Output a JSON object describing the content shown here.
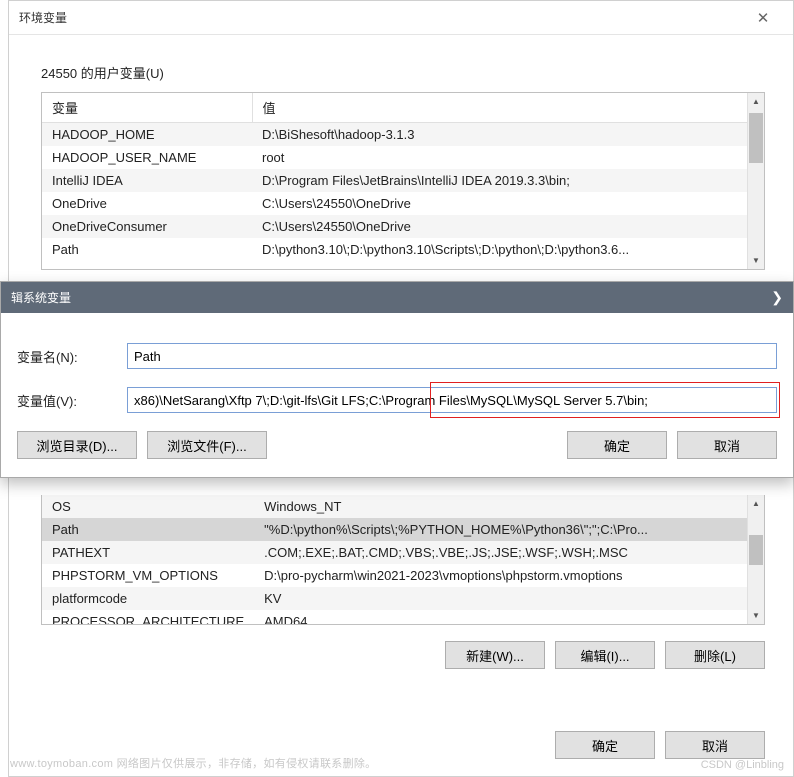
{
  "dialog": {
    "title": "环境变量",
    "close_glyph": "✕"
  },
  "user_section": {
    "label": "24550 的用户变量(U)",
    "header_var": "变量",
    "header_val": "值",
    "rows": [
      {
        "var": "HADOOP_HOME",
        "val": "D:\\BiShesoft\\hadoop-3.1.3"
      },
      {
        "var": "HADOOP_USER_NAME",
        "val": "root"
      },
      {
        "var": "IntelliJ IDEA",
        "val": "D:\\Program Files\\JetBrains\\IntelliJ IDEA 2019.3.3\\bin;"
      },
      {
        "var": "OneDrive",
        "val": "C:\\Users\\24550\\OneDrive"
      },
      {
        "var": "OneDriveConsumer",
        "val": "C:\\Users\\24550\\OneDrive"
      },
      {
        "var": "Path",
        "val": "D:\\python3.10\\;D:\\python3.10\\Scripts\\;D:\\python\\;D:\\python3.6..."
      }
    ]
  },
  "edit_dialog": {
    "title": "辑系统变量",
    "close_glyph": "❯",
    "name_label": "变量名(N):",
    "value_label": "变量值(V):",
    "name_value": "Path",
    "value_value": "x86)\\NetSarang\\Xftp 7\\;D:\\git-lfs\\Git LFS;C:\\Program Files\\MySQL\\MySQL Server 5.7\\bin;",
    "browse_dir": "浏览目录(D)...",
    "browse_file": "浏览文件(F)...",
    "ok": "确定",
    "cancel": "取消"
  },
  "sys_section": {
    "rows": [
      {
        "var": "OS",
        "val": "Windows_NT",
        "sel": false
      },
      {
        "var": "Path",
        "val": "\"%D:\\python%\\Scripts\\;%PYTHON_HOME%\\Python36\\\";\";C:\\Pro...",
        "sel": true
      },
      {
        "var": "PATHEXT",
        "val": ".COM;.EXE;.BAT;.CMD;.VBS;.VBE;.JS;.JSE;.WSF;.WSH;.MSC",
        "sel": false
      },
      {
        "var": "PHPSTORM_VM_OPTIONS",
        "val": "D:\\pro-pycharm\\win2021-2023\\vmoptions\\phpstorm.vmoptions",
        "sel": false
      },
      {
        "var": "platformcode",
        "val": "KV",
        "sel": false
      },
      {
        "var": "PROCESSOR_ARCHITECTURE",
        "val": "AMD64",
        "sel": false
      }
    ],
    "new_btn": "新建(W)...",
    "edit_btn": "编辑(I)...",
    "delete_btn": "删除(L)"
  },
  "final": {
    "ok": "确定",
    "cancel": "取消"
  },
  "watermark": {
    "left": "www.toymoban.com  网络图片仅供展示，非存储，如有侵权请联系删除。",
    "right": "CSDN @Linbling"
  }
}
